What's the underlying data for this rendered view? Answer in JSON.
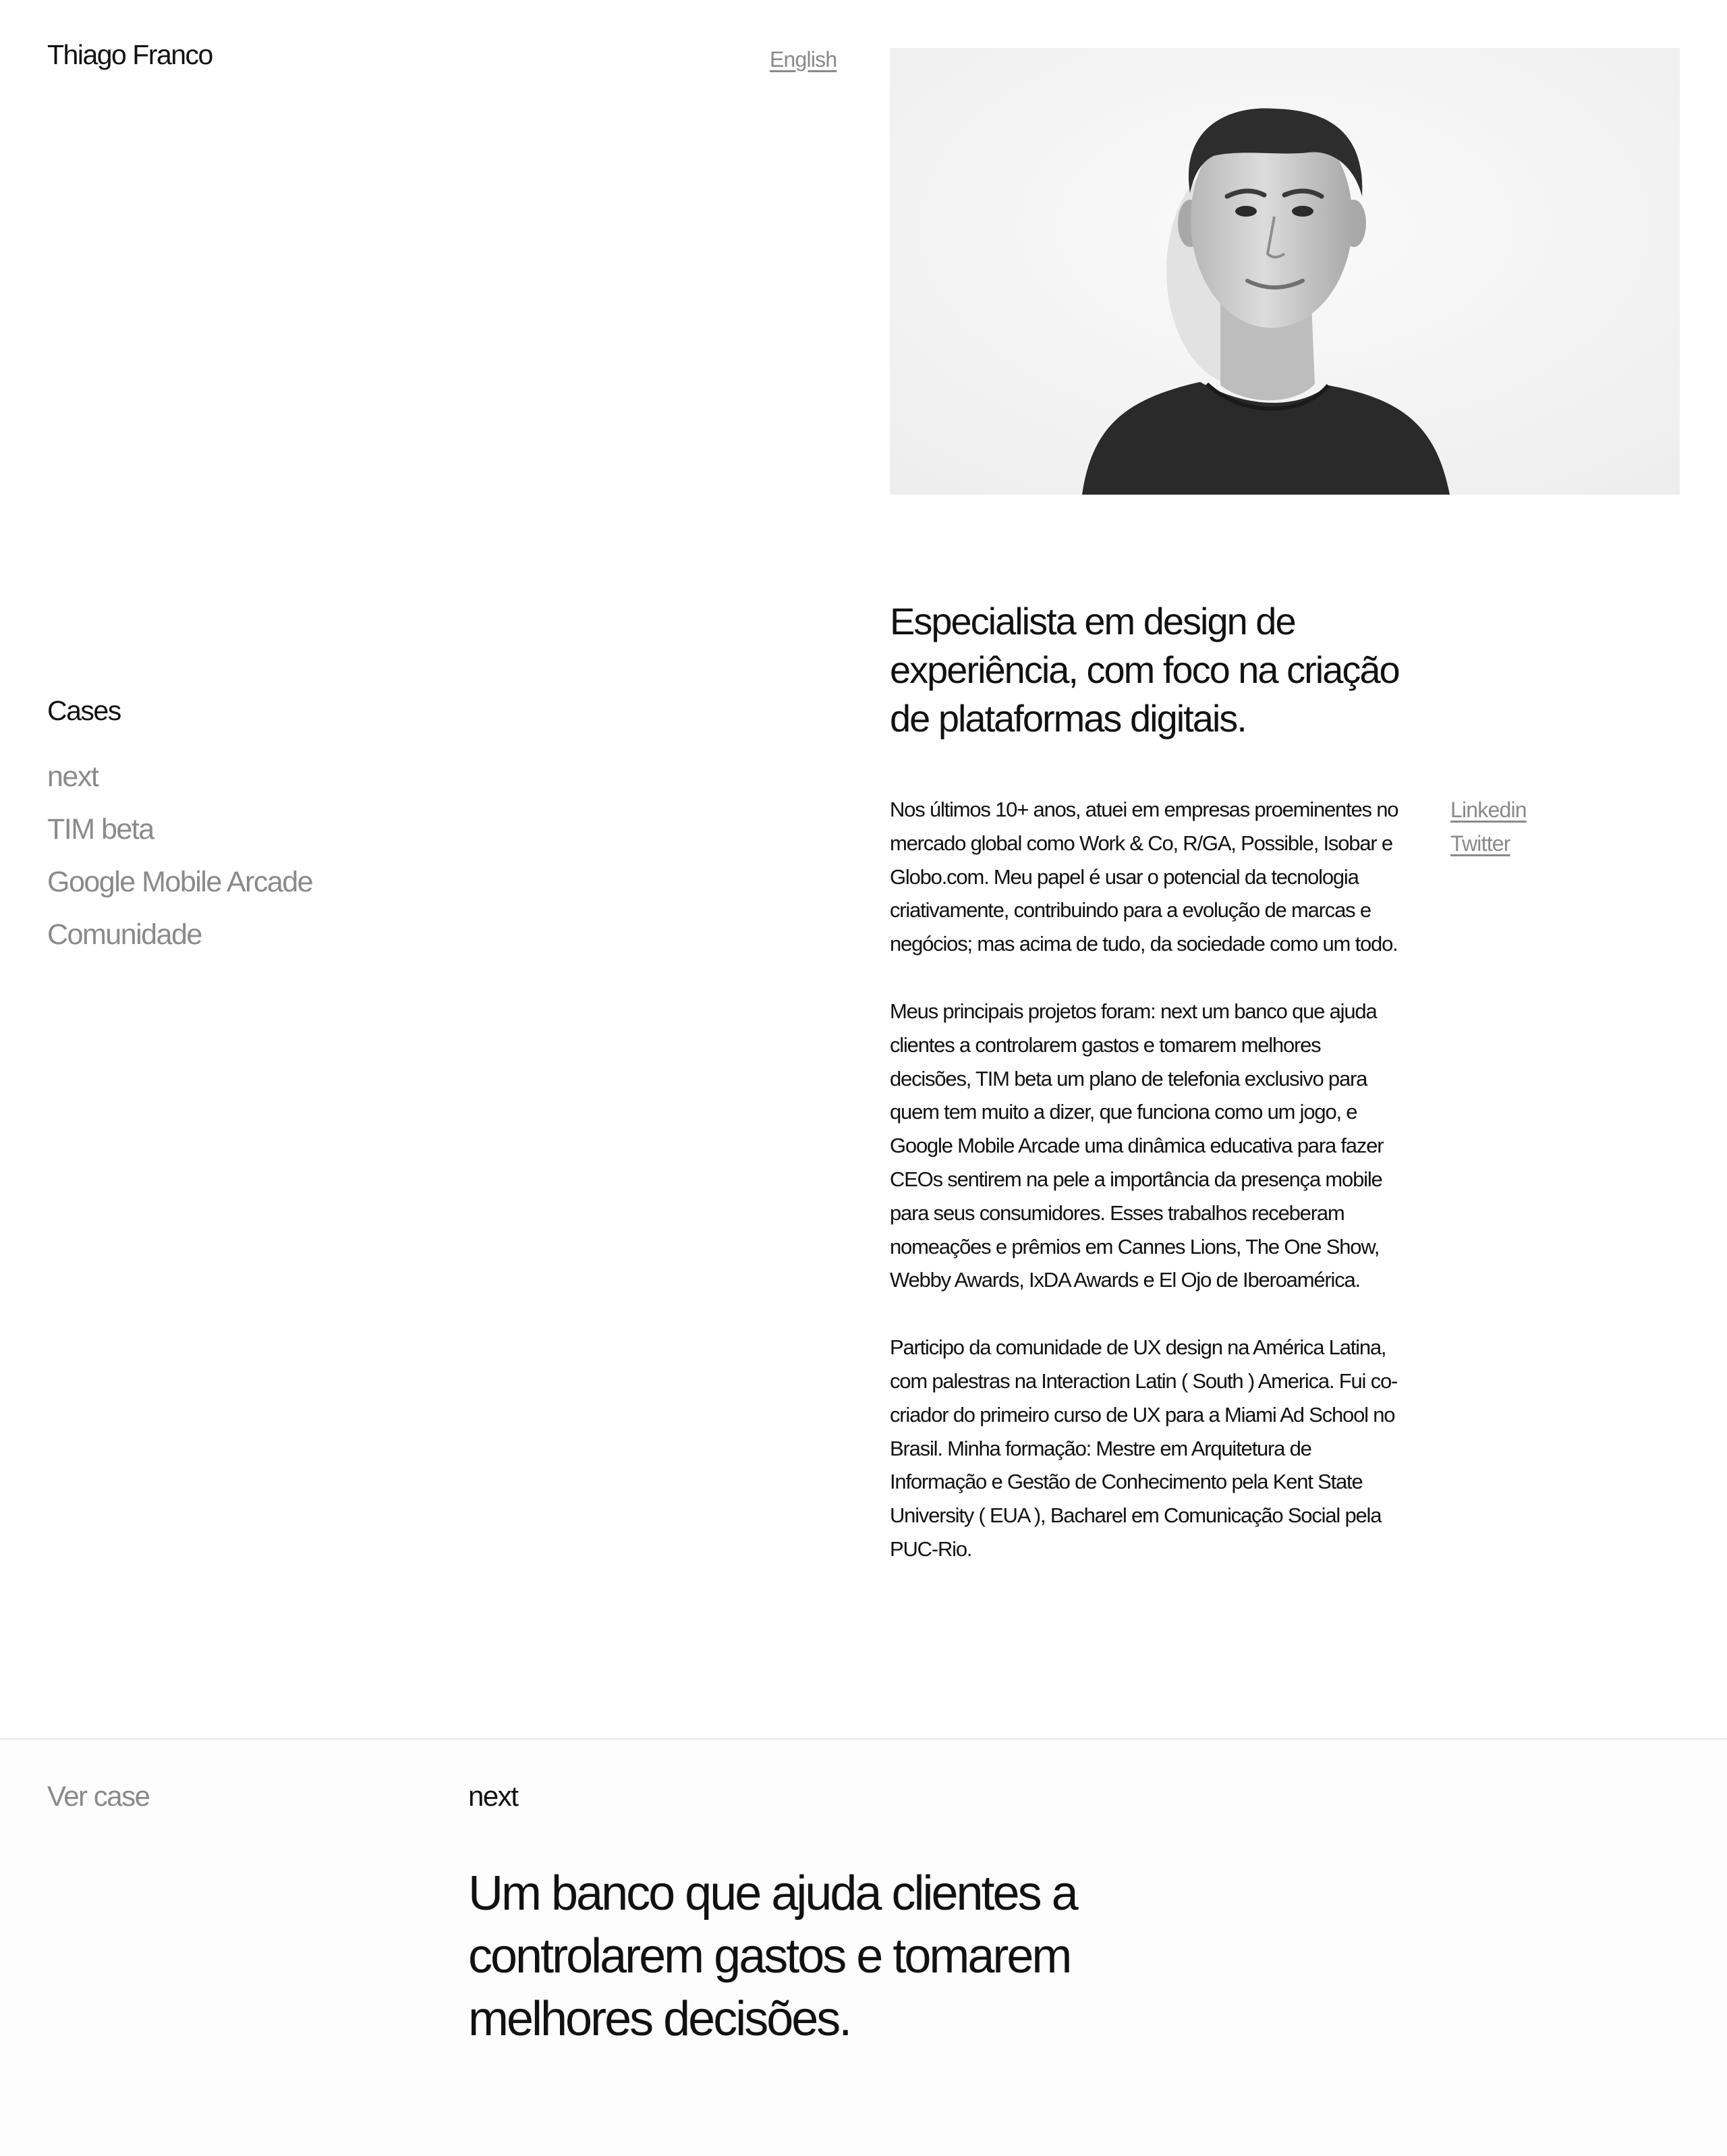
{
  "header": {
    "site_name": "Thiago Franco",
    "language_link": "English"
  },
  "portrait": {
    "alt": "Black and white portrait photo"
  },
  "cases": {
    "title": "Cases",
    "items": [
      "next",
      "TIM beta",
      "Google Mobile Arcade",
      "Comunidade"
    ]
  },
  "intro": {
    "headline": "Especialista em design de experiência, com foco na criação de plataformas digitais.",
    "paragraphs": [
      "Nos últimos 10+ anos, atuei em empresas proeminentes no mercado global como Work & Co, R/GA, Possible, Isobar e Globo.com. Meu papel é usar o potencial da tecnologia criativamente, contribuindo para a evolução de marcas e negócios; mas acima de tudo, da sociedade como um todo.",
      "Meus principais projetos foram: next um banco que ajuda clientes a controlarem gastos e tomarem melhores decisões, TIM beta um plano de telefonia exclusivo para quem tem muito a dizer, que funciona como um jogo, e Google Mobile Arcade uma dinâmica educativa para fazer CEOs sentirem na pele a importância da presença mobile para seus consumidores. Esses trabalhos receberam nomeações e prêmios em Cannes Lions, The One Show, Webby Awards, IxDA Awards e El Ojo de Iberoamérica.",
      "Participo da comunidade de UX design na América Latina, com palestras na Interaction Latin ( South ) America. Fui co-criador do primeiro curso de UX para a Miami Ad School no Brasil. Minha formação: Mestre em Arquitetura de Informação e Gestão de Conhecimento pela Kent State University ( EUA ), Bacharel em Comunicação Social pela PUC-Rio."
    ]
  },
  "social": {
    "linkedin": "Linkedin",
    "twitter": "Twitter"
  },
  "featured_case": {
    "cta": "Ver case",
    "name": "next",
    "tagline": "Um banco que ajuda clientes a controlarem gastos e tomarem melhores decisões."
  },
  "colors": {
    "text": "#111111",
    "muted": "#8a8a8a",
    "background": "#ffffff",
    "divider": "#e8e8e8"
  }
}
